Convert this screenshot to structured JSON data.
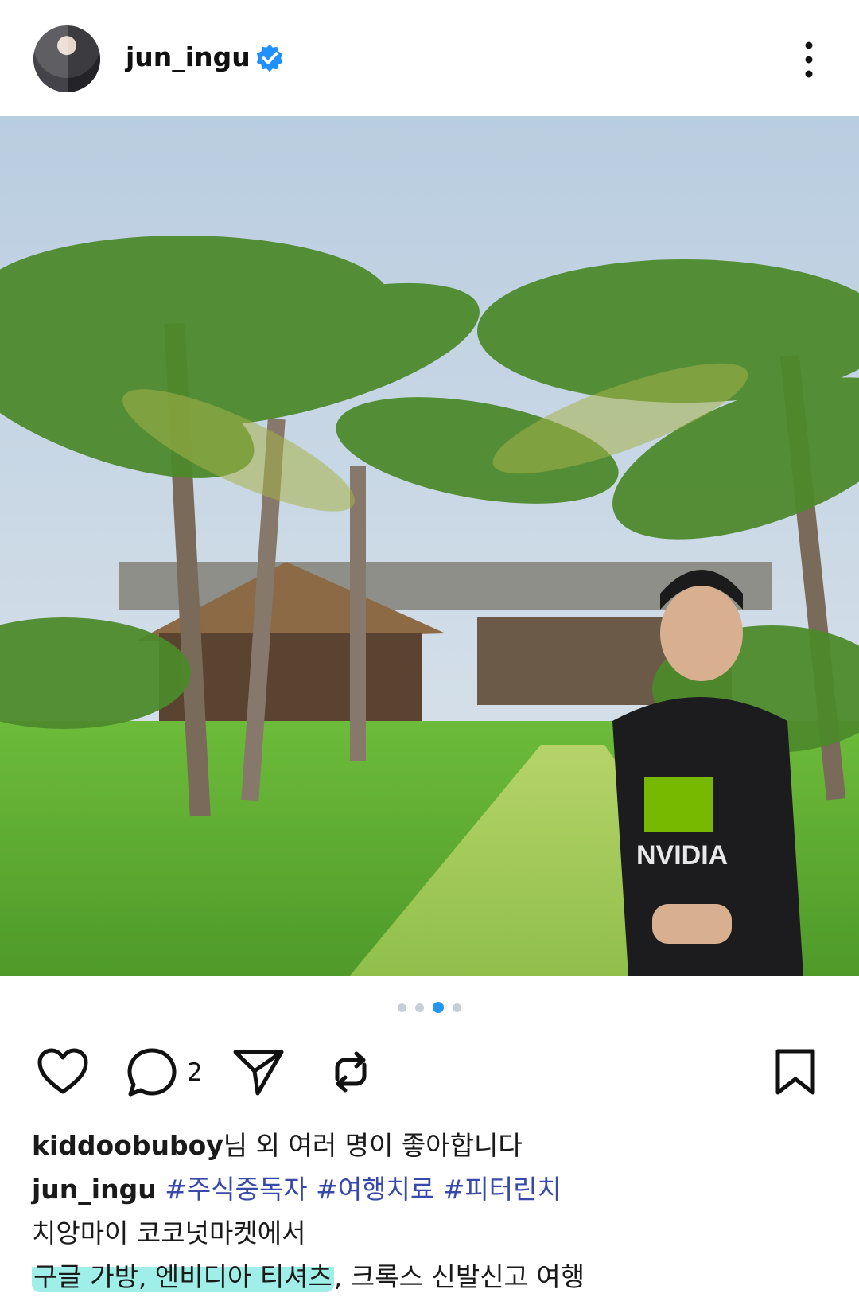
{
  "header": {
    "username": "jun_ingu",
    "verified_icon": "verified-badge-icon",
    "more_icon": "more-vertical-icon"
  },
  "post": {
    "image_alt_icon": "photo",
    "carousel": {
      "count": 4,
      "active": 3
    }
  },
  "actions": {
    "like_icon": "heart-icon",
    "comment_icon": "comment-bubble-icon",
    "comment_count": "2",
    "share_icon": "send-paper-plane-icon",
    "repost_icon": "repost-icon",
    "save_icon": "bookmark-icon"
  },
  "likes": {
    "user": "kiddoobuboy",
    "suffix": "님 외 여러 명이 좋아합니다"
  },
  "caption": {
    "author": "jun_ingu",
    "hashtags": [
      "#주식중독자",
      "#여행치료",
      "#피터린치"
    ],
    "line1": "치앙마이 코코넛마켓에서",
    "line2_highlight": "구글 가방, 엔비디아 티셔츠",
    "line2_rest": ", 크록스 신발신고 여행"
  },
  "colors": {
    "accent_blue": "#2196f3",
    "hashtag": "#3949ab",
    "highlight": "#80e9e1",
    "verified": "#1e90ff"
  }
}
